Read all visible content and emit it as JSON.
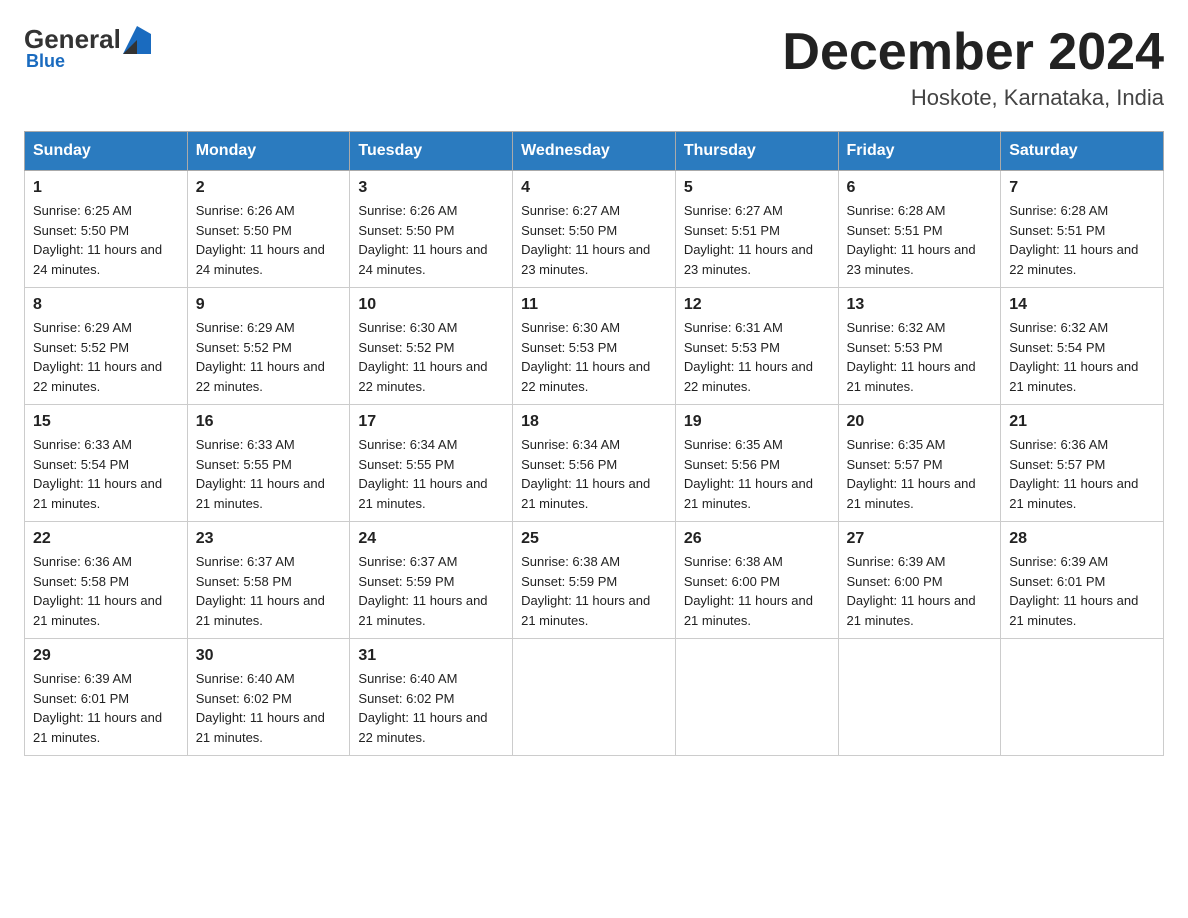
{
  "header": {
    "logo": {
      "general": "General",
      "blue": "Blue"
    },
    "title": "December 2024",
    "location": "Hoskote, Karnataka, India"
  },
  "weekdays": [
    "Sunday",
    "Monday",
    "Tuesday",
    "Wednesday",
    "Thursday",
    "Friday",
    "Saturday"
  ],
  "weeks": [
    [
      {
        "day": "1",
        "sunrise": "6:25 AM",
        "sunset": "5:50 PM",
        "daylight": "11 hours and 24 minutes."
      },
      {
        "day": "2",
        "sunrise": "6:26 AM",
        "sunset": "5:50 PM",
        "daylight": "11 hours and 24 minutes."
      },
      {
        "day": "3",
        "sunrise": "6:26 AM",
        "sunset": "5:50 PM",
        "daylight": "11 hours and 24 minutes."
      },
      {
        "day": "4",
        "sunrise": "6:27 AM",
        "sunset": "5:50 PM",
        "daylight": "11 hours and 23 minutes."
      },
      {
        "day": "5",
        "sunrise": "6:27 AM",
        "sunset": "5:51 PM",
        "daylight": "11 hours and 23 minutes."
      },
      {
        "day": "6",
        "sunrise": "6:28 AM",
        "sunset": "5:51 PM",
        "daylight": "11 hours and 23 minutes."
      },
      {
        "day": "7",
        "sunrise": "6:28 AM",
        "sunset": "5:51 PM",
        "daylight": "11 hours and 22 minutes."
      }
    ],
    [
      {
        "day": "8",
        "sunrise": "6:29 AM",
        "sunset": "5:52 PM",
        "daylight": "11 hours and 22 minutes."
      },
      {
        "day": "9",
        "sunrise": "6:29 AM",
        "sunset": "5:52 PM",
        "daylight": "11 hours and 22 minutes."
      },
      {
        "day": "10",
        "sunrise": "6:30 AM",
        "sunset": "5:52 PM",
        "daylight": "11 hours and 22 minutes."
      },
      {
        "day": "11",
        "sunrise": "6:30 AM",
        "sunset": "5:53 PM",
        "daylight": "11 hours and 22 minutes."
      },
      {
        "day": "12",
        "sunrise": "6:31 AM",
        "sunset": "5:53 PM",
        "daylight": "11 hours and 22 minutes."
      },
      {
        "day": "13",
        "sunrise": "6:32 AM",
        "sunset": "5:53 PM",
        "daylight": "11 hours and 21 minutes."
      },
      {
        "day": "14",
        "sunrise": "6:32 AM",
        "sunset": "5:54 PM",
        "daylight": "11 hours and 21 minutes."
      }
    ],
    [
      {
        "day": "15",
        "sunrise": "6:33 AM",
        "sunset": "5:54 PM",
        "daylight": "11 hours and 21 minutes."
      },
      {
        "day": "16",
        "sunrise": "6:33 AM",
        "sunset": "5:55 PM",
        "daylight": "11 hours and 21 minutes."
      },
      {
        "day": "17",
        "sunrise": "6:34 AM",
        "sunset": "5:55 PM",
        "daylight": "11 hours and 21 minutes."
      },
      {
        "day": "18",
        "sunrise": "6:34 AM",
        "sunset": "5:56 PM",
        "daylight": "11 hours and 21 minutes."
      },
      {
        "day": "19",
        "sunrise": "6:35 AM",
        "sunset": "5:56 PM",
        "daylight": "11 hours and 21 minutes."
      },
      {
        "day": "20",
        "sunrise": "6:35 AM",
        "sunset": "5:57 PM",
        "daylight": "11 hours and 21 minutes."
      },
      {
        "day": "21",
        "sunrise": "6:36 AM",
        "sunset": "5:57 PM",
        "daylight": "11 hours and 21 minutes."
      }
    ],
    [
      {
        "day": "22",
        "sunrise": "6:36 AM",
        "sunset": "5:58 PM",
        "daylight": "11 hours and 21 minutes."
      },
      {
        "day": "23",
        "sunrise": "6:37 AM",
        "sunset": "5:58 PM",
        "daylight": "11 hours and 21 minutes."
      },
      {
        "day": "24",
        "sunrise": "6:37 AM",
        "sunset": "5:59 PM",
        "daylight": "11 hours and 21 minutes."
      },
      {
        "day": "25",
        "sunrise": "6:38 AM",
        "sunset": "5:59 PM",
        "daylight": "11 hours and 21 minutes."
      },
      {
        "day": "26",
        "sunrise": "6:38 AM",
        "sunset": "6:00 PM",
        "daylight": "11 hours and 21 minutes."
      },
      {
        "day": "27",
        "sunrise": "6:39 AM",
        "sunset": "6:00 PM",
        "daylight": "11 hours and 21 minutes."
      },
      {
        "day": "28",
        "sunrise": "6:39 AM",
        "sunset": "6:01 PM",
        "daylight": "11 hours and 21 minutes."
      }
    ],
    [
      {
        "day": "29",
        "sunrise": "6:39 AM",
        "sunset": "6:01 PM",
        "daylight": "11 hours and 21 minutes."
      },
      {
        "day": "30",
        "sunrise": "6:40 AM",
        "sunset": "6:02 PM",
        "daylight": "11 hours and 21 minutes."
      },
      {
        "day": "31",
        "sunrise": "6:40 AM",
        "sunset": "6:02 PM",
        "daylight": "11 hours and 22 minutes."
      },
      null,
      null,
      null,
      null
    ]
  ]
}
